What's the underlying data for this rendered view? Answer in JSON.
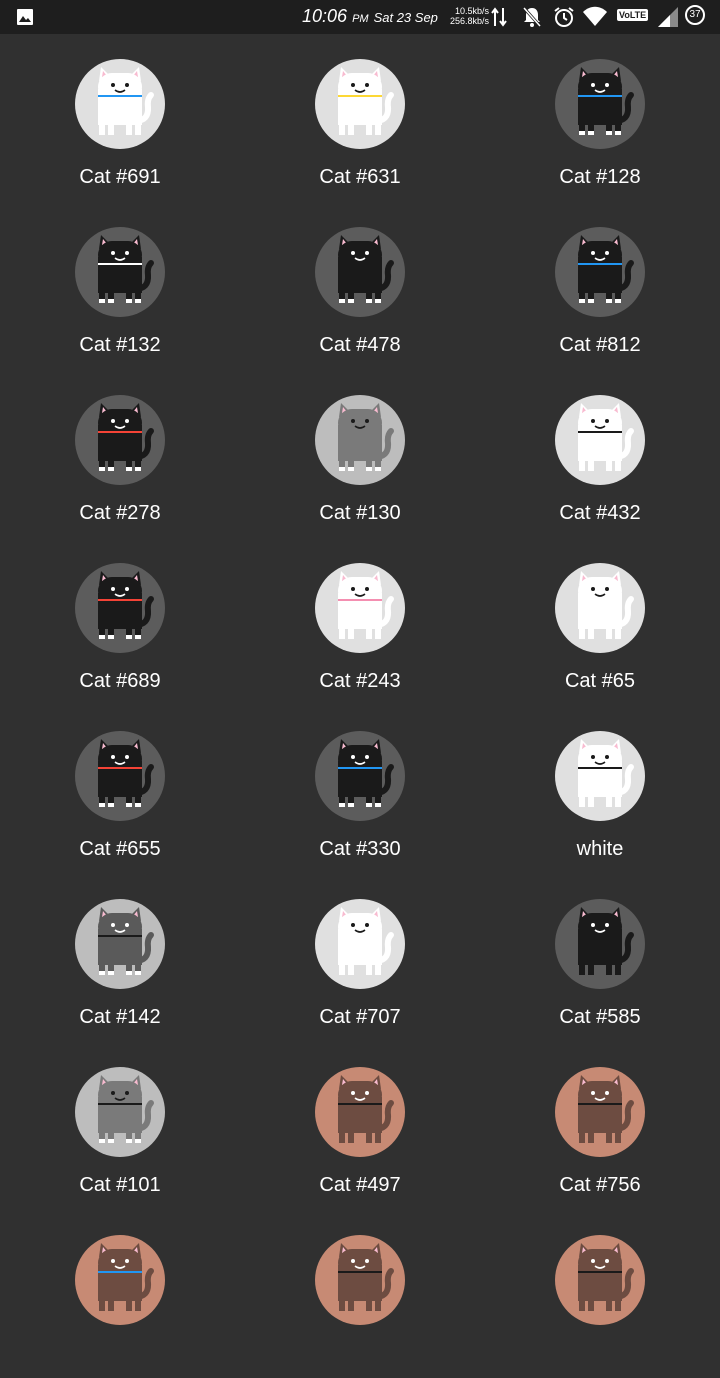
{
  "status_bar": {
    "time": "10:06",
    "ampm": "PM",
    "date": "Sat 23 Sep",
    "net_up": "10.5kb/s",
    "net_down": "256.8kb/s",
    "volte": "VoLTE",
    "battery": "37"
  },
  "cats": [
    {
      "name": "Cat #691",
      "bg": "#e0e0e0",
      "body": "#ffffff",
      "collar": "#2196f3",
      "paws": "#ffffff"
    },
    {
      "name": "Cat #631",
      "bg": "#e0e0e0",
      "body": "#ffffff",
      "collar": "#fdd835",
      "paws": "#ffffff"
    },
    {
      "name": "Cat #128",
      "bg": "#5c5c5c",
      "body": "#1a1a1a",
      "collar": "#2196f3",
      "paws": "#ffffff"
    },
    {
      "name": "Cat #132",
      "bg": "#5c5c5c",
      "body": "#1a1a1a",
      "collar": "#ffffff",
      "paws": "#ffffff"
    },
    {
      "name": "Cat #478",
      "bg": "#5c5c5c",
      "body": "#1a1a1a",
      "collar": "",
      "paws": "#ffffff"
    },
    {
      "name": "Cat #812",
      "bg": "#5c5c5c",
      "body": "#1a1a1a",
      "collar": "#2196f3",
      "paws": "#ffffff"
    },
    {
      "name": "Cat #278",
      "bg": "#5c5c5c",
      "body": "#1a1a1a",
      "collar": "#f44336",
      "paws": "#ffffff"
    },
    {
      "name": "Cat #130",
      "bg": "#bdbdbd",
      "body": "#7a7a7a",
      "collar": "",
      "paws": "#ffffff"
    },
    {
      "name": "Cat #432",
      "bg": "#e0e0e0",
      "body": "#ffffff",
      "collar": "#1a1a1a",
      "paws": "#ffffff"
    },
    {
      "name": "Cat #689",
      "bg": "#5c5c5c",
      "body": "#1a1a1a",
      "collar": "#f44336",
      "paws": "#ffffff"
    },
    {
      "name": "Cat #243",
      "bg": "#e0e0e0",
      "body": "#ffffff",
      "collar": "#f48fb1",
      "paws": "#ffffff"
    },
    {
      "name": "Cat #65",
      "bg": "#e0e0e0",
      "body": "#ffffff",
      "collar": "",
      "paws": "#ffffff"
    },
    {
      "name": "Cat #655",
      "bg": "#5c5c5c",
      "body": "#1a1a1a",
      "collar": "#f44336",
      "paws": "#ffffff"
    },
    {
      "name": "Cat #330",
      "bg": "#5c5c5c",
      "body": "#1a1a1a",
      "collar": "#2196f3",
      "paws": "#ffffff"
    },
    {
      "name": "white",
      "bg": "#e0e0e0",
      "body": "#ffffff",
      "collar": "#1a1a1a",
      "paws": "#ffffff"
    },
    {
      "name": "Cat #142",
      "bg": "#bdbdbd",
      "body": "#5a5a5a",
      "collar": "#1a1a1a",
      "paws": "#ffffff"
    },
    {
      "name": "Cat #707",
      "bg": "#e0e0e0",
      "body": "#ffffff",
      "collar": "",
      "paws": "#ffffff"
    },
    {
      "name": "Cat #585",
      "bg": "#5c5c5c",
      "body": "#1a1a1a",
      "collar": "#1a1a1a",
      "paws": "#1a1a1a"
    },
    {
      "name": "Cat #101",
      "bg": "#bdbdbd",
      "body": "#7a7a7a",
      "collar": "#1a1a1a",
      "paws": "#ffffff"
    },
    {
      "name": "Cat #497",
      "bg": "#c78a74",
      "body": "#6d4c41",
      "collar": "#1a1a1a",
      "paws": "#6d4c41"
    },
    {
      "name": "Cat #756",
      "bg": "#c78a74",
      "body": "#6d4c41",
      "collar": "#1a1a1a",
      "paws": "#6d4c41"
    },
    {
      "name": "",
      "bg": "#c78a74",
      "body": "#6d4c41",
      "collar": "#2196f3",
      "paws": "#6d4c41"
    },
    {
      "name": "",
      "bg": "#c78a74",
      "body": "#6d4c41",
      "collar": "#1a1a1a",
      "paws": "#6d4c41"
    },
    {
      "name": "",
      "bg": "#c78a74",
      "body": "#6d4c41",
      "collar": "#1a1a1a",
      "paws": "#6d4c41"
    }
  ]
}
